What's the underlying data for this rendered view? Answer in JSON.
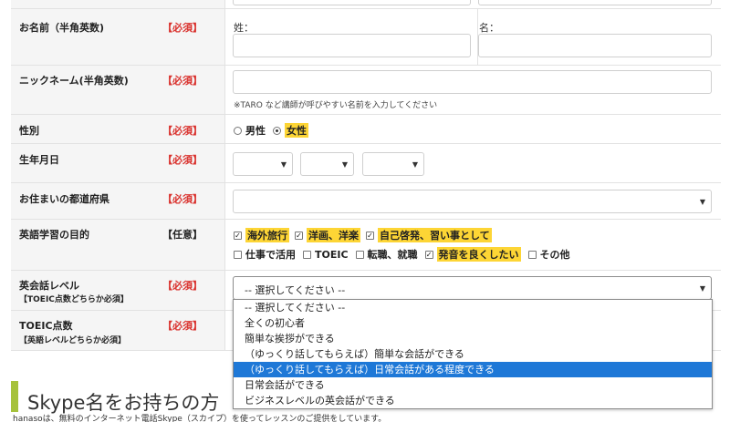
{
  "rows": {
    "name": {
      "label": "お名前（半角英数)",
      "req": "【必須】",
      "last_prefix": "姓：",
      "first_prefix": "名："
    },
    "nickname": {
      "label": "ニックネーム(半角英数)",
      "req": "【必須】",
      "note": "※TARO など講師が呼びやすい名前を入力してください"
    },
    "gender": {
      "label": "性別",
      "req": "【必須】",
      "male": "男性",
      "female": "女性"
    },
    "birth": {
      "label": "生年月日",
      "req": "【必須】"
    },
    "prefecture": {
      "label": "お住まいの都道府県",
      "req": "【必須】"
    },
    "purpose": {
      "label": "英語学習の目的",
      "opt": "【任意】",
      "items": [
        "海外旅行",
        "洋画、洋楽",
        "自己啓発、習い事として",
        "仕事で活用",
        "TOEIC",
        "転職、就職",
        "発音を良くしたい",
        "その他"
      ],
      "checked": [
        true,
        true,
        true,
        false,
        false,
        false,
        true,
        false
      ]
    },
    "level": {
      "label": "英会話レベル",
      "sub": "【TOEIC点数どちらか必須】",
      "req": "【必須】",
      "selected": "-- 選択してください --"
    },
    "toeic": {
      "label": "TOEIC点数",
      "sub": "【英語レベルどちらか必須】",
      "req": "【必須】"
    }
  },
  "dropdown": {
    "options": [
      "-- 選択してください --",
      "全くの初心者",
      "簡単な挨拶ができる",
      "（ゆっくり話してもらえば）簡単な会話ができる",
      "（ゆっくり話してもらえば）日常会話がある程度できる",
      "日常会話ができる",
      "ビジネスレベルの英会話ができる"
    ],
    "highlighted_index": 4
  },
  "section": {
    "title": "Skype名をお持ちの方",
    "desc": "hanasoは、無料のインターネット電話Skype（スカイプ）を使ってレッスンのご提供をしています。"
  },
  "colors": {
    "required": "#d9302c",
    "highlight": "#fdd535",
    "accent_bar": "#a6c23c",
    "selected_option": "#1e78d7"
  }
}
